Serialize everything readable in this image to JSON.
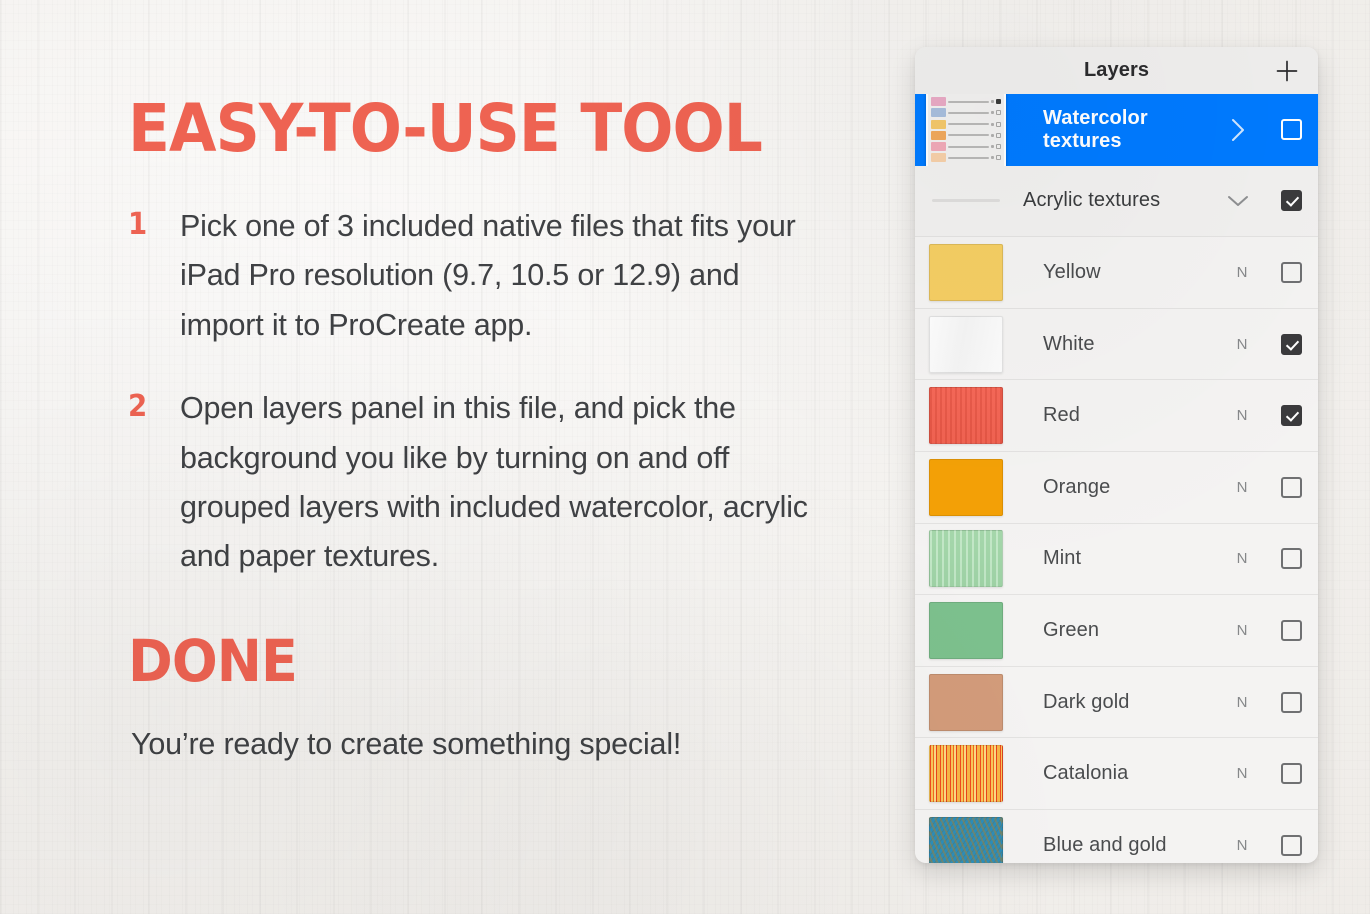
{
  "promo": {
    "headline": "EASY-TO-USE TOOL",
    "steps": [
      {
        "num": "1",
        "text": "Pick one of 3 included native files that fits your iPad Pro resolution (9.7, 10.5 or 12.9) and import it to ProCreate app."
      },
      {
        "num": "2",
        "text": "Open layers panel in this file, and pick the background you like by turning on and off grouped layers with included watercolor, acrylic and paper textures."
      }
    ],
    "done_heading": "DONE",
    "done_subtext": "You’re ready to create something special!"
  },
  "accent_color": "#ee6352",
  "selection_color": "#007aff",
  "panel": {
    "title": "Layers",
    "add_icon": "plus-icon",
    "groups": [
      {
        "label": "Watercolor textures",
        "selected": true,
        "expanded": false,
        "chevron_icon": "chevron-right-icon",
        "visible": false,
        "thumbnail_icon": "layer-group-thumbnail",
        "thumbnail_swatches": [
          "#e8a9c4",
          "#a8bedd",
          "#f3c76a",
          "#f0a85c",
          "#f0a9b8",
          "#f6cfa8"
        ]
      },
      {
        "label": "Acrylic textures",
        "selected": false,
        "expanded": true,
        "chevron_icon": "chevron-down-icon",
        "visible": true,
        "thumbnail_icon": "group-divider-line"
      }
    ],
    "layers": [
      {
        "name": "Yellow",
        "blend_mode": "N",
        "visible": false,
        "color": "#f5ce63",
        "texture": "flat"
      },
      {
        "name": "White",
        "blend_mode": "N",
        "visible": true,
        "color": "#fbfbfb",
        "texture": "flat"
      },
      {
        "name": "Red",
        "blend_mode": "N",
        "visible": true,
        "color": "#f4604f",
        "texture": "streak"
      },
      {
        "name": "Orange",
        "blend_mode": "N",
        "visible": false,
        "color": "#f4a106",
        "texture": "flat"
      },
      {
        "name": "Mint",
        "blend_mode": "N",
        "visible": false,
        "color": "#a8dcae",
        "texture": "streak"
      },
      {
        "name": "Green",
        "blend_mode": "N",
        "visible": false,
        "color": "#7cc08d",
        "texture": "flat"
      },
      {
        "name": "Dark gold",
        "blend_mode": "N",
        "visible": false,
        "color": "#d29b7a",
        "texture": "flat"
      },
      {
        "name": "Catalonia",
        "blend_mode": "N",
        "visible": false,
        "color": "#f7b545",
        "texture": "catalonia"
      },
      {
        "name": "Blue and gold",
        "blend_mode": "N",
        "visible": false,
        "color": "#2b8dba",
        "texture": "bluegold"
      }
    ]
  }
}
